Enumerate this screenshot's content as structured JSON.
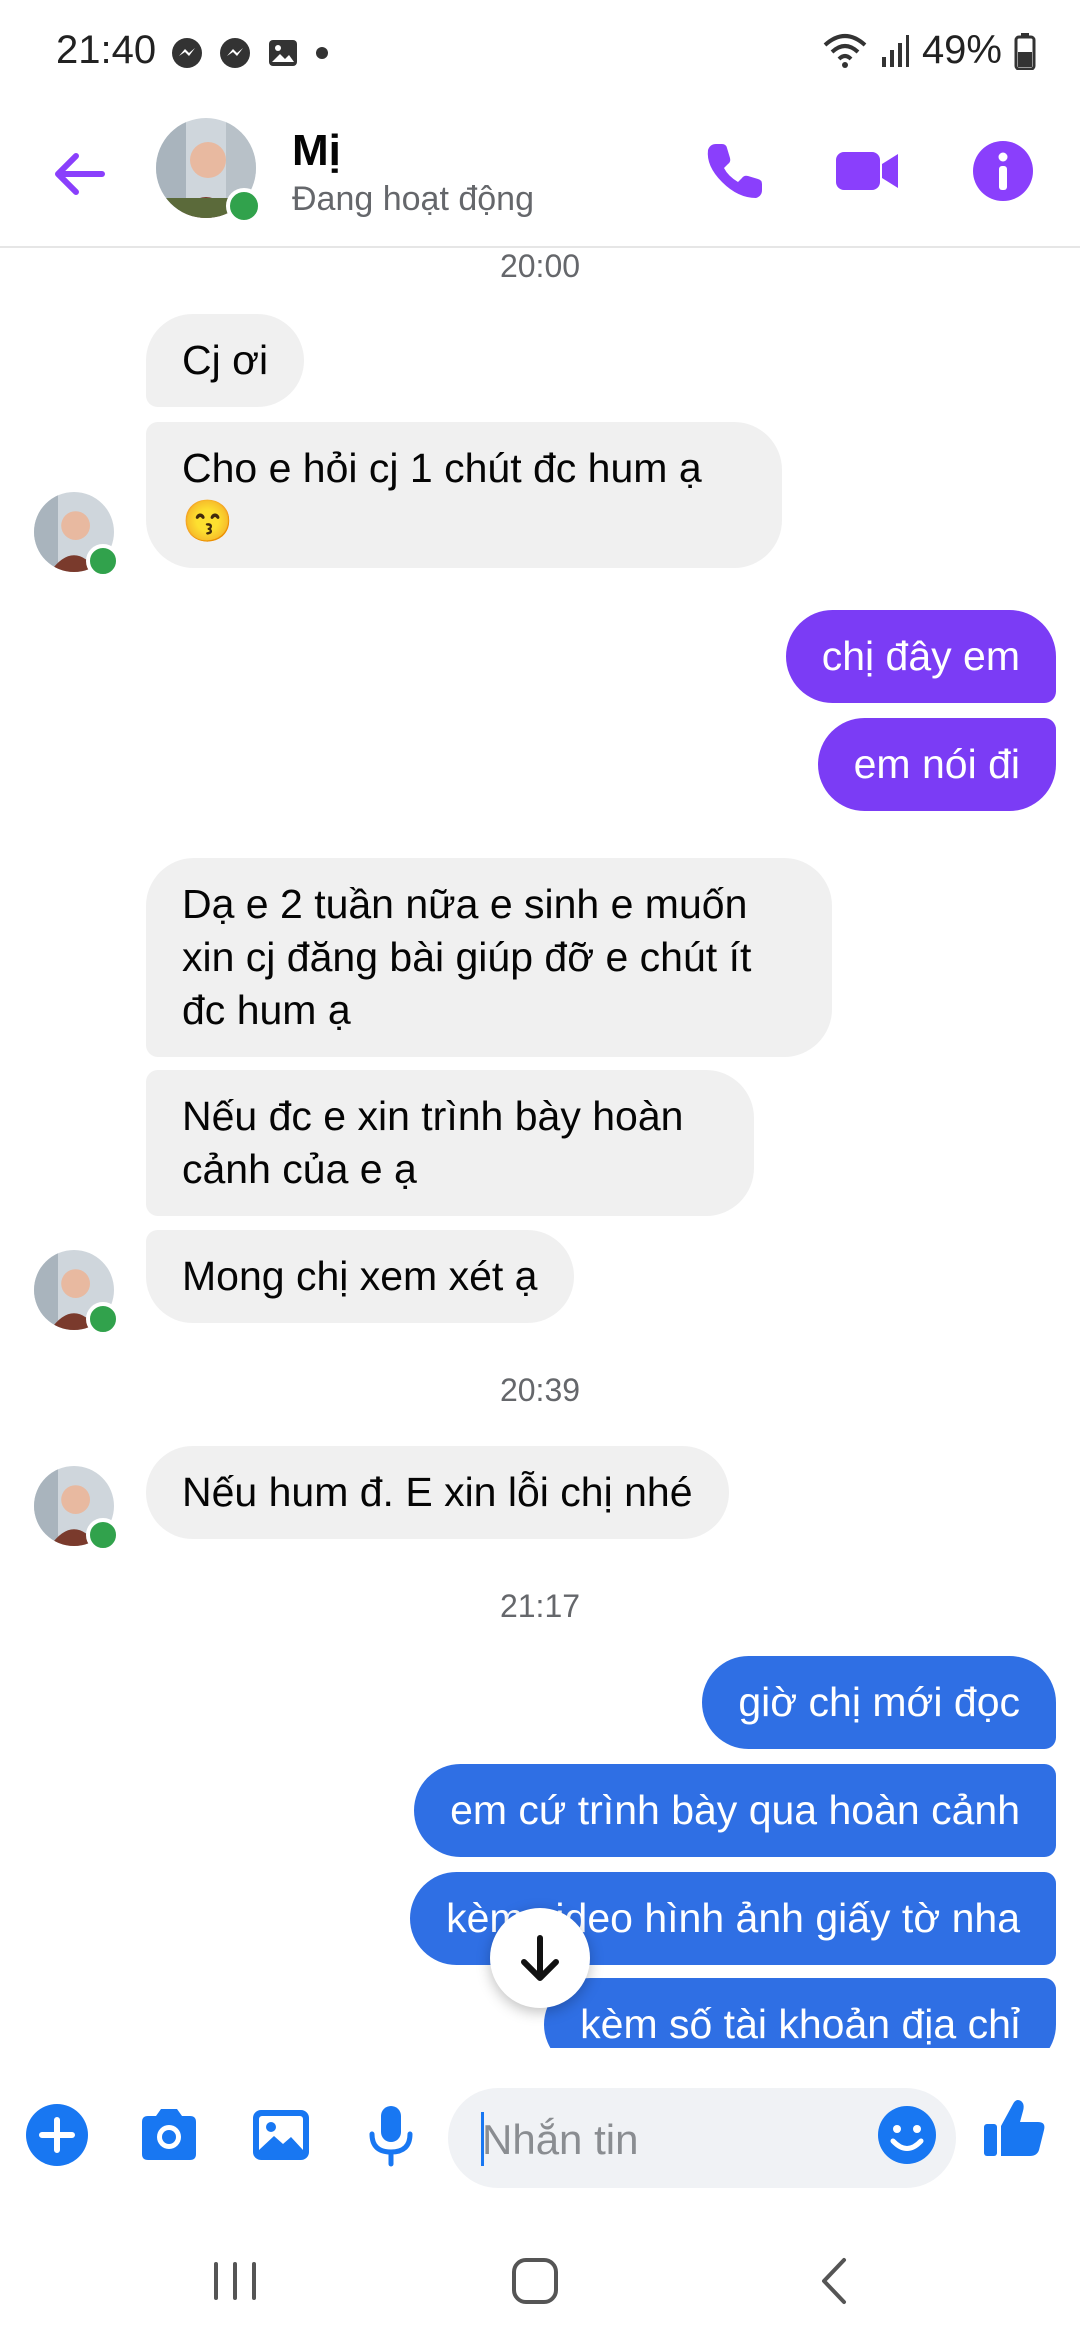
{
  "status_bar": {
    "time": "21:40",
    "battery": "49%"
  },
  "header": {
    "name": "Mị",
    "status": "Đang hoạt động"
  },
  "messages": [
    {
      "type": "timestamp",
      "text": "20:00"
    },
    {
      "type": "in",
      "text": "Cj ơi"
    },
    {
      "type": "in",
      "text": "Cho e hỏi cj 1 chút đc hum ạ",
      "emoji": "😙"
    },
    {
      "type": "out",
      "text": "chị đây em"
    },
    {
      "type": "out",
      "text": "em nói đi"
    },
    {
      "type": "in",
      "lines": [
        "Dạ e 2 tuần nữa e sinh e muốn",
        "xin cj đăng bài giúp đỡ e chút ít",
        "đc hum ạ"
      ]
    },
    {
      "type": "in",
      "lines": [
        "Nếu đc e xin trình bày hoàn",
        "cảnh của e ạ"
      ]
    },
    {
      "type": "in",
      "text": "Mong chị xem xét ạ"
    },
    {
      "type": "timestamp",
      "text": "20:39"
    },
    {
      "type": "in",
      "text": "Nếu hum đ. E xin lỗi chị nhé"
    },
    {
      "type": "timestamp",
      "text": "21:17"
    },
    {
      "type": "out",
      "text": "giờ chị mới đọc"
    },
    {
      "type": "out",
      "text": "em cứ trình bày qua hoàn cảnh"
    },
    {
      "type": "out",
      "text": "kèm video hình ảnh giấy tờ nha"
    },
    {
      "type": "out",
      "text": "kèm số tài khoản địa chỉ"
    }
  ],
  "composer": {
    "placeholder": "Nhắn tin"
  },
  "colors": {
    "accent": "#8a3ffc",
    "outgoing_purple": "#7b3cf5",
    "outgoing_blue": "#2f6fe4",
    "incoming": "#f0f0f0",
    "online": "#31a24c"
  },
  "icons": [
    "messenger-icon",
    "image-notification-icon",
    "wifi-icon",
    "signal-icon",
    "battery-icon",
    "back-arrow-icon",
    "phone-icon",
    "video-camera-icon",
    "info-icon",
    "plus-icon",
    "camera-icon",
    "gallery-icon",
    "microphone-icon",
    "emoji-icon",
    "like-icon",
    "arrow-down-icon"
  ]
}
